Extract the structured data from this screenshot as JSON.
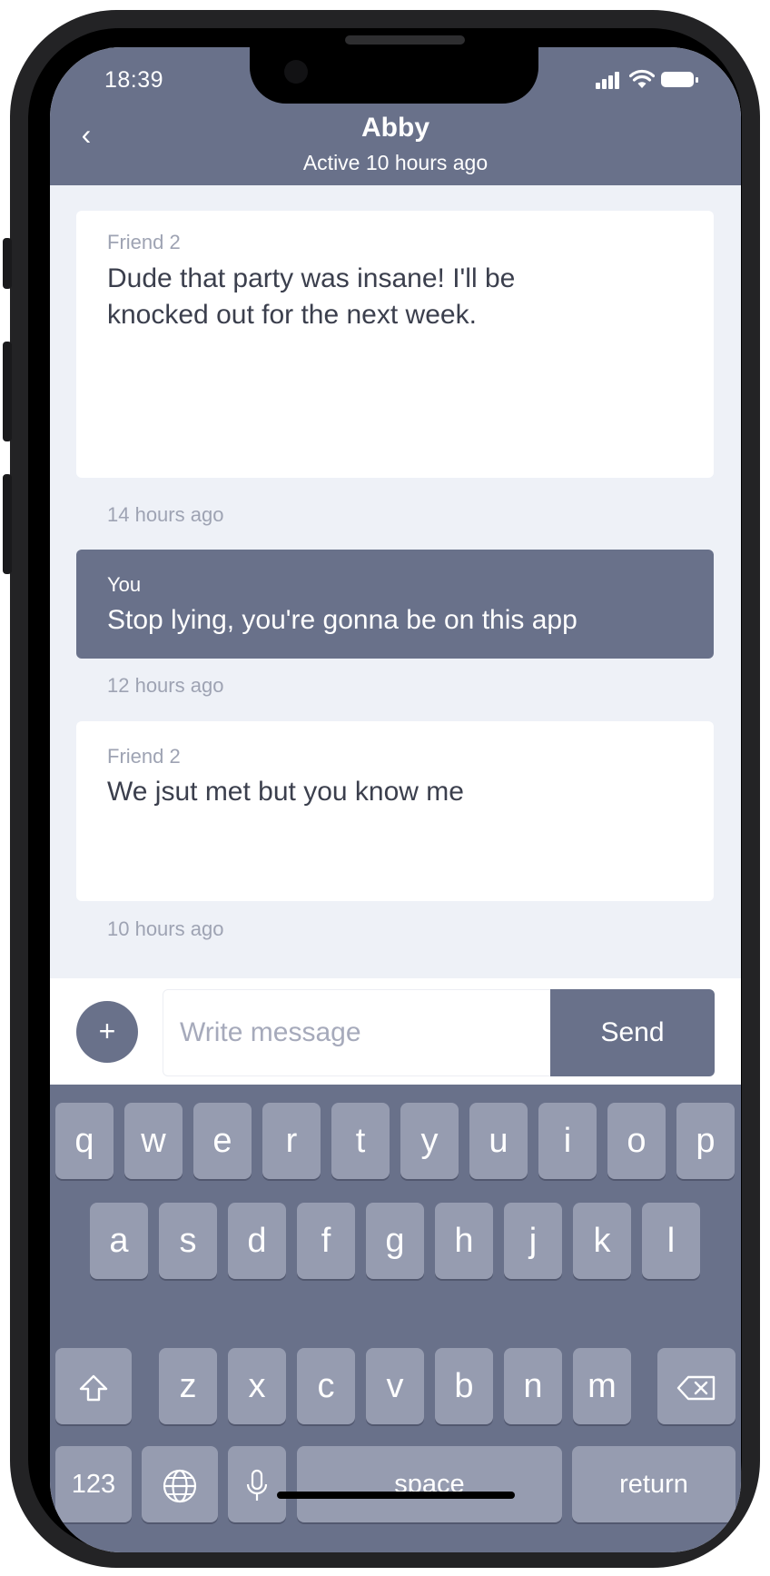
{
  "status_bar": {
    "time": "18:39"
  },
  "header": {
    "back_icon": "chevron-left-icon",
    "back_glyph": "‹",
    "contact_name": "Abby",
    "contact_status": "Active 10 hours ago"
  },
  "messages": [
    {
      "sender": "Friend 2",
      "text": "Dude that party was insane! I'll be knocked out for the next week.",
      "timestamp": "14 hours ago",
      "side": "friend"
    },
    {
      "sender": "You",
      "text": "Stop lying, you're gonna be on this app",
      "timestamp": "12 hours ago",
      "side": "mine"
    },
    {
      "sender": "Friend 2",
      "text": "We jsut met but you know me",
      "timestamp": "10 hours ago",
      "side": "friend"
    }
  ],
  "composer": {
    "add_icon": "plus-icon",
    "add_glyph": "+",
    "placeholder": "Write message",
    "value": "",
    "send_label": "Send"
  },
  "keyboard": {
    "row1": [
      "q",
      "w",
      "e",
      "r",
      "t",
      "y",
      "u",
      "i",
      "o",
      "p"
    ],
    "row2": [
      "a",
      "s",
      "d",
      "f",
      "g",
      "h",
      "j",
      "k",
      "l"
    ],
    "row3": [
      "z",
      "x",
      "c",
      "v",
      "b",
      "n",
      "m"
    ],
    "shift_icon": "shift-icon",
    "backspace_icon": "backspace-icon",
    "numbers_label": "123",
    "globe_icon": "globe-icon",
    "mic_icon": "microphone-icon",
    "space_label": "space",
    "return_label": "return"
  },
  "colors": {
    "accent": "#69718a",
    "background": "#eef1f7",
    "key": "#969cb0",
    "muted_text": "#9ea3b3"
  }
}
